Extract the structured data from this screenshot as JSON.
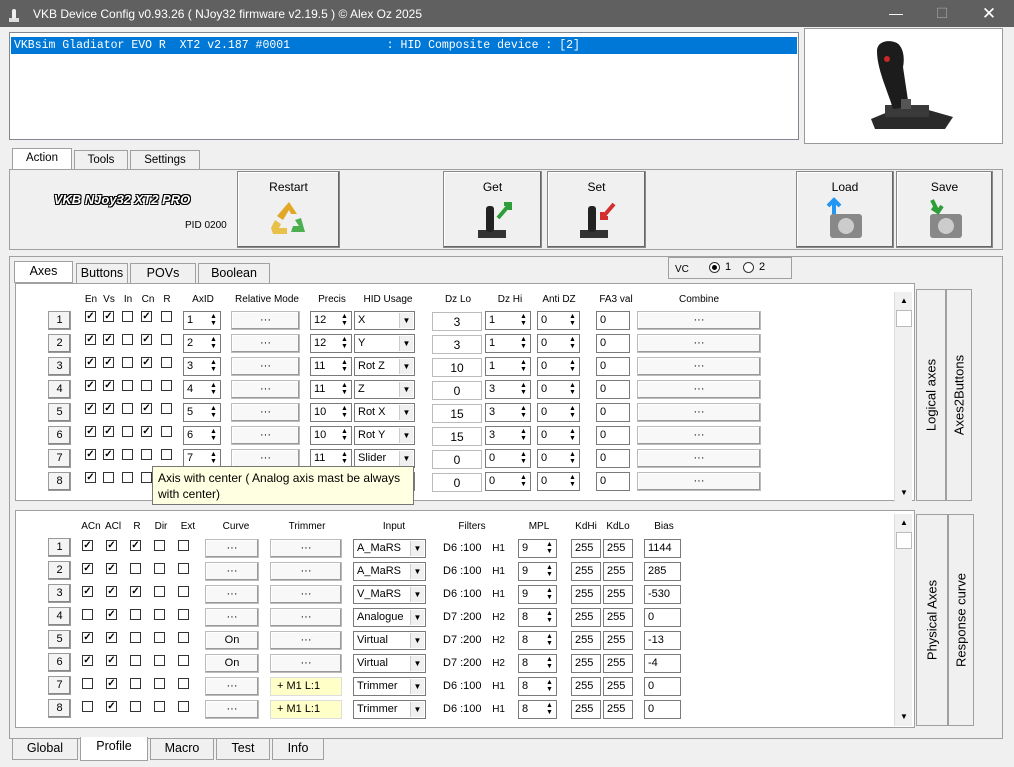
{
  "window": {
    "title": "VKB Device Config v0.93.26 ( NJoy32 firmware v2.19.5 ) © Alex Oz 2025"
  },
  "device_list": {
    "row": "VKBsim Gladiator EVO R  XT2 v2.187 #0001              : HID Composite device : [2]"
  },
  "main_tabs": [
    {
      "label": "Action"
    },
    {
      "label": "Tools"
    },
    {
      "label": "Settings"
    }
  ],
  "toolbar": {
    "device_name": "VKB NJoy32 XT2 PRO",
    "pid": "PID 0200",
    "restart": "Restart",
    "get": "Get",
    "set": "Set",
    "load": "Load",
    "save": "Save"
  },
  "sub_tabs": [
    {
      "label": "Axes"
    },
    {
      "label": "Buttons"
    },
    {
      "label": "POVs"
    },
    {
      "label": "Boolean"
    }
  ],
  "vc": {
    "label": "VC",
    "opt1": "1",
    "opt2": "2",
    "selected": "1"
  },
  "logical": {
    "headers": {
      "en": "En",
      "vs": "Vs",
      "in": "In",
      "cn": "Cn",
      "r": "R",
      "axid": "AxID",
      "relmode": "Relative Mode",
      "precis": "Precis",
      "hid": "HID Usage",
      "dzlo": "Dz Lo",
      "dzhi": "Dz Hi",
      "antidz": "Anti DZ",
      "fa3": "FA3 val",
      "combine": "Combine"
    },
    "rows": [
      {
        "n": "1",
        "en": true,
        "vs": true,
        "in": false,
        "cn": true,
        "r": false,
        "axid": "1",
        "rel": "···",
        "precis": "12",
        "hid": "X",
        "dzlo": "3",
        "dzhi": "1",
        "antidz": "0",
        "fa3": "0",
        "combine": "···"
      },
      {
        "n": "2",
        "en": true,
        "vs": true,
        "in": false,
        "cn": true,
        "r": false,
        "axid": "2",
        "rel": "···",
        "precis": "12",
        "hid": "Y",
        "dzlo": "3",
        "dzhi": "1",
        "antidz": "0",
        "fa3": "0",
        "combine": "···"
      },
      {
        "n": "3",
        "en": true,
        "vs": true,
        "in": false,
        "cn": true,
        "r": false,
        "axid": "3",
        "rel": "···",
        "precis": "11",
        "hid": "Rot Z",
        "dzlo": "10",
        "dzhi": "1",
        "antidz": "0",
        "fa3": "0",
        "combine": "···"
      },
      {
        "n": "4",
        "en": true,
        "vs": true,
        "in": false,
        "cn": false,
        "r": false,
        "axid": "4",
        "rel": "···",
        "precis": "11",
        "hid": "Z",
        "dzlo": "0",
        "dzhi": "3",
        "antidz": "0",
        "fa3": "0",
        "combine": "···"
      },
      {
        "n": "5",
        "en": true,
        "vs": true,
        "in": false,
        "cn": true,
        "r": false,
        "axid": "5",
        "rel": "···",
        "precis": "10",
        "hid": "Rot X",
        "dzlo": "15",
        "dzhi": "3",
        "antidz": "0",
        "fa3": "0",
        "combine": "···"
      },
      {
        "n": "6",
        "en": true,
        "vs": true,
        "in": false,
        "cn": true,
        "r": false,
        "axid": "6",
        "rel": "···",
        "precis": "10",
        "hid": "Rot Y",
        "dzlo": "15",
        "dzhi": "3",
        "antidz": "0",
        "fa3": "0",
        "combine": "···"
      },
      {
        "n": "7",
        "en": true,
        "vs": true,
        "in": false,
        "cn": false,
        "r": false,
        "axid": "7",
        "rel": "···",
        "precis": "11",
        "hid": "Slider",
        "dzlo": "0",
        "dzhi": "0",
        "antidz": "0",
        "fa3": "0",
        "combine": "···"
      },
      {
        "n": "8",
        "en": true,
        "vs": false,
        "in": false,
        "cn": false,
        "r": false,
        "axid": "8",
        "rel": "···",
        "precis": "11",
        "hid": "Slider",
        "dzlo": "0",
        "dzhi": "0",
        "antidz": "0",
        "fa3": "0",
        "combine": "···"
      }
    ],
    "side_tabs": {
      "logical": "Logical axes",
      "a2b": "Axes2Buttons"
    }
  },
  "tooltip": "Axis with center ( Analog axis mast be always with center)",
  "physical": {
    "headers": {
      "acn": "ACn",
      "acl": "ACl",
      "r": "R",
      "dir": "Dir",
      "ext": "Ext",
      "curve": "Curve",
      "trimmer": "Trimmer",
      "input": "Input",
      "filters": "Filters",
      "mpl": "MPL",
      "kdhi": "KdHi",
      "kdlo": "KdLo",
      "bias": "Bias"
    },
    "rows": [
      {
        "n": "1",
        "acn": true,
        "acl": true,
        "r": true,
        "dir": false,
        "ext": false,
        "curve": "···",
        "trim": "···",
        "trimhl": false,
        "input": "A_MaRS",
        "filter": "D6 :100",
        "fh": "H1",
        "mpl": "9",
        "kdhi": "255",
        "kdlo": "255",
        "bias": "1144"
      },
      {
        "n": "2",
        "acn": true,
        "acl": true,
        "r": false,
        "dir": false,
        "ext": false,
        "curve": "···",
        "trim": "···",
        "trimhl": false,
        "input": "A_MaRS",
        "filter": "D6 :100",
        "fh": "H1",
        "mpl": "9",
        "kdhi": "255",
        "kdlo": "255",
        "bias": "285"
      },
      {
        "n": "3",
        "acn": true,
        "acl": true,
        "r": true,
        "dir": false,
        "ext": false,
        "curve": "···",
        "trim": "···",
        "trimhl": false,
        "input": "V_MaRS",
        "filter": "D6 :100",
        "fh": "H1",
        "mpl": "9",
        "kdhi": "255",
        "kdlo": "255",
        "bias": "-530"
      },
      {
        "n": "4",
        "acn": false,
        "acl": true,
        "r": false,
        "dir": false,
        "ext": false,
        "curve": "···",
        "trim": "···",
        "trimhl": false,
        "input": "Analogue",
        "filter": "D7 :200",
        "fh": "H2",
        "mpl": "8",
        "kdhi": "255",
        "kdlo": "255",
        "bias": "0"
      },
      {
        "n": "5",
        "acn": true,
        "acl": true,
        "r": false,
        "dir": false,
        "ext": false,
        "curve": "On",
        "trim": "···",
        "trimhl": false,
        "input": "Virtual",
        "filter": "D7 :200",
        "fh": "H2",
        "mpl": "8",
        "kdhi": "255",
        "kdlo": "255",
        "bias": "-13"
      },
      {
        "n": "6",
        "acn": true,
        "acl": true,
        "r": false,
        "dir": false,
        "ext": false,
        "curve": "On",
        "trim": "···",
        "trimhl": false,
        "input": "Virtual",
        "filter": "D7 :200",
        "fh": "H2",
        "mpl": "8",
        "kdhi": "255",
        "kdlo": "255",
        "bias": "-4"
      },
      {
        "n": "7",
        "acn": false,
        "acl": true,
        "r": false,
        "dir": false,
        "ext": false,
        "curve": "···",
        "trim": "+   M1  L:1",
        "trimhl": true,
        "input": "Trimmer",
        "filter": "D6 :100",
        "fh": "H1",
        "mpl": "8",
        "kdhi": "255",
        "kdlo": "255",
        "bias": "0"
      },
      {
        "n": "8",
        "acn": false,
        "acl": true,
        "r": false,
        "dir": false,
        "ext": false,
        "curve": "···",
        "trim": "+   M1  L:1",
        "trimhl": true,
        "input": "Trimmer",
        "filter": "D6 :100",
        "fh": "H1",
        "mpl": "8",
        "kdhi": "255",
        "kdlo": "255",
        "bias": "0"
      }
    ],
    "side_tabs": {
      "physical": "Physical Axes",
      "curve": "Response curve"
    }
  },
  "bottom_tabs": [
    {
      "label": "Global"
    },
    {
      "label": "Profile"
    },
    {
      "label": "Macro"
    },
    {
      "label": "Test"
    },
    {
      "label": "Info"
    }
  ],
  "colors": {
    "accent": "#0078d7",
    "titlebar": "#606060",
    "tooltip": "#ffffe1",
    "trimmer_hl": "#ffffc8"
  }
}
